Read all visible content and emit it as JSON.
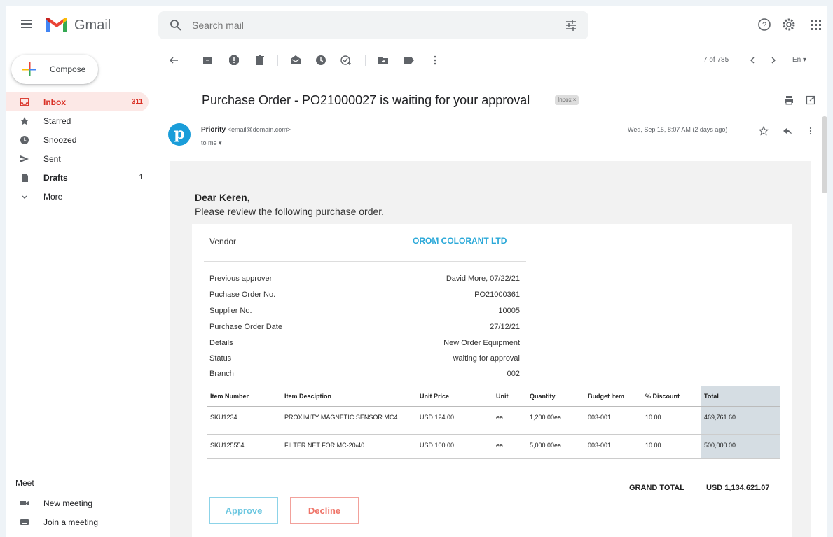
{
  "app": {
    "brand": "Gmail"
  },
  "search": {
    "placeholder": "Search mail"
  },
  "sidebar": {
    "compose": "Compose",
    "items": [
      {
        "label": "Inbox",
        "count": "311",
        "icon": "inbox-icon",
        "active": true
      },
      {
        "label": "Starred",
        "count": "",
        "icon": "star-icon"
      },
      {
        "label": "Snoozed",
        "count": "",
        "icon": "clock-icon"
      },
      {
        "label": "Sent",
        "count": "",
        "icon": "send-icon"
      },
      {
        "label": "Drafts",
        "count": "1",
        "icon": "draft-icon"
      },
      {
        "label": "More",
        "count": "",
        "icon": "chevron-down-icon"
      }
    ],
    "meet": {
      "title": "Meet",
      "new_meeting": "New meeting",
      "join_meeting": "Join a meeting"
    }
  },
  "toolbar": {
    "pager": "7 of 785",
    "lang": "En"
  },
  "email": {
    "subject": "Purchase Order  - PO21000027 is waiting for your approval",
    "label_chip": "Inbox ×",
    "sender_name": "Priority",
    "sender_email": "<email@domain.com>",
    "to": "to me",
    "date": "Wed, Sep 15, 8:07 AM (2 days ago)",
    "avatar_letter": "p"
  },
  "body": {
    "greeting": "Dear Keren,",
    "intro": "Please review the following purchase order.",
    "vendor_label": "Vendor",
    "vendor_value": "OROM COLORANT LTD",
    "details": [
      {
        "k": "Previous approver",
        "v": "David More, 07/22/21"
      },
      {
        "k": "Puchase Order No.",
        "v": "PO21000361"
      },
      {
        "k": "Supplier No.",
        "v": "10005"
      },
      {
        "k": "Purchase Order Date",
        "v": "27/12/21"
      },
      {
        "k": "Details",
        "v": "New Order Equipment"
      },
      {
        "k": "Status",
        "v": "waiting for approval"
      },
      {
        "k": "Branch",
        "v": "002"
      }
    ],
    "table": {
      "headers": [
        "Item  Number",
        "Item  Desciption",
        "Unit Price",
        "Unit",
        "Quantity",
        "Budget Item",
        "% Discount",
        "Total"
      ],
      "rows": [
        [
          "SKU1234",
          "PROXIMITY MAGNETIC SENSOR MC4",
          "USD 124.00",
          "ea",
          "1,200.00ea",
          "003-001",
          "10.00",
          "469,761.60"
        ],
        [
          "SKU125554",
          "FILTER NET FOR MC-20/40",
          "USD 100.00",
          "ea",
          "5,000.00ea",
          "003-001",
          "10.00",
          "500,000.00"
        ]
      ]
    },
    "grand_total_label": "GRAND TOTAL",
    "grand_total_value": "USD  1,134,621.07",
    "approve": "Approve",
    "decline": "Decline"
  },
  "colors": {
    "accent": "#2aa8d8",
    "inbox_red": "#d93025",
    "approve": "#6cc7e0",
    "decline": "#ef7468"
  }
}
